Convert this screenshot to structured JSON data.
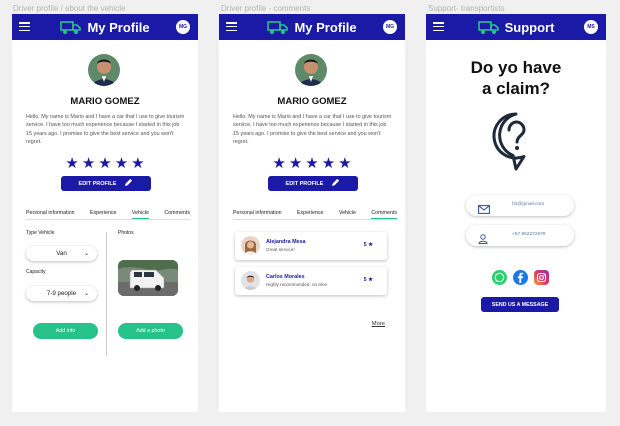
{
  "captions": [
    "Driver profile / about the vehicle",
    "Driver profile - comments",
    "Support- transportists"
  ],
  "avatar_initials": "MG",
  "colors": {
    "primary": "#1a1aa6",
    "green": "#27c28a"
  },
  "screen1": {
    "title": "My Profile",
    "name": "MARIO GOMEZ",
    "bio": "Hello. My name is Mario and I have a car that I use to give tourism service. I have too much experience because I started in this job 15 years ago. I promise to give the best service and you won't regret.",
    "rating": 5,
    "edit_label": "EDIT PROFILE",
    "tabs": [
      "Personal information",
      "Experience",
      "Vehicle",
      "Comments"
    ],
    "active_tab": "Vehicle",
    "type_label": "Type Vehicle",
    "type_value": "Van",
    "capacity_label": "Capacity",
    "capacity_value": "7-9 people",
    "photos_label": "Photos",
    "add_info": "Add info",
    "add_photo": "Add a photo"
  },
  "screen2": {
    "title": "My Profile",
    "name": "MARIO GOMEZ",
    "bio": "Hello. My name is Mario and I have a car that I use to give tourism service. I have too much experience because I started in this job 15 years ago. I promise to give the best service and you won't regret.",
    "rating": 5,
    "edit_label": "EDIT PROFILE",
    "tabs": [
      "Personal information",
      "Experience",
      "Vehicle",
      "Comments"
    ],
    "active_tab": "Comments",
    "comments": [
      {
        "name": "Alejandra Mesa",
        "text": "Great service!",
        "rating": "5"
      },
      {
        "name": "Carlos Morales",
        "text": "Highly recommended, on time",
        "rating": "5"
      }
    ],
    "more": "More"
  },
  "screen3": {
    "title": "Support",
    "avatar_initials": "MS",
    "claim_line1": "Do yo have",
    "claim_line2": "a claim?",
    "email": "f2t@gmail.com",
    "phone": "+57 962272679",
    "social_icons": [
      "whatsapp-icon",
      "facebook-icon",
      "instagram-icon"
    ],
    "send_label": "SEND US A MESSAGE"
  }
}
